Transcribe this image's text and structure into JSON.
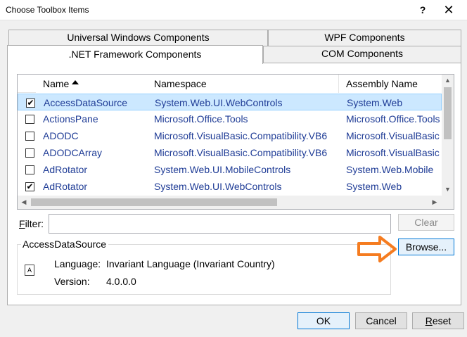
{
  "window": {
    "title": "Choose Toolbox Items",
    "help_label": "?",
    "close_label": "✕"
  },
  "tabs": {
    "uwp": "Universal Windows Components",
    "wpf": "WPF Components",
    "net": ".NET Framework Components",
    "com": "COM Components"
  },
  "list": {
    "columns": {
      "name": "Name",
      "namespace": "Namespace",
      "assembly": "Assembly Name"
    },
    "sort": {
      "column": "name",
      "direction": "ascending"
    },
    "rows": [
      {
        "checked": true,
        "name": "AccessDataSource",
        "namespace": "System.Web.UI.WebControls",
        "assembly": "System.Web",
        "selected": true
      },
      {
        "checked": false,
        "name": "ActionsPane",
        "namespace": "Microsoft.Office.Tools",
        "assembly": "Microsoft.Office.Tools"
      },
      {
        "checked": false,
        "name": "ADODC",
        "namespace": "Microsoft.VisualBasic.Compatibility.VB6",
        "assembly": "Microsoft.VisualBasic"
      },
      {
        "checked": false,
        "name": "ADODCArray",
        "namespace": "Microsoft.VisualBasic.Compatibility.VB6",
        "assembly": "Microsoft.VisualBasic"
      },
      {
        "checked": false,
        "name": "AdRotator",
        "namespace": "System.Web.UI.MobileControls",
        "assembly": "System.Web.Mobile"
      },
      {
        "checked": true,
        "name": "AdRotator",
        "namespace": "System.Web.UI.WebControls",
        "assembly": "System.Web"
      }
    ],
    "check_glyph": "✔",
    "scroll_up": "▲",
    "scroll_down": "▼",
    "scroll_left": "◀",
    "scroll_right": "▶"
  },
  "filter": {
    "label_mnemonic": "F",
    "label_rest": "ilter:",
    "value": "",
    "clear_label": "Clear"
  },
  "browse_label": "Browse...",
  "info": {
    "title": "AccessDataSource",
    "language_key": "Language:",
    "language_value": "Invariant Language (Invariant Country)",
    "version_key": "Version:",
    "version_value": "4.0.0.0"
  },
  "buttons": {
    "ok": "OK",
    "cancel": "Cancel",
    "reset_mnemonic": "R",
    "reset_rest": "eset"
  },
  "colors": {
    "selection": "#cce8ff",
    "link_text": "#1f3c96",
    "arrow": "#f57c20",
    "focus_border": "#0078d7"
  }
}
